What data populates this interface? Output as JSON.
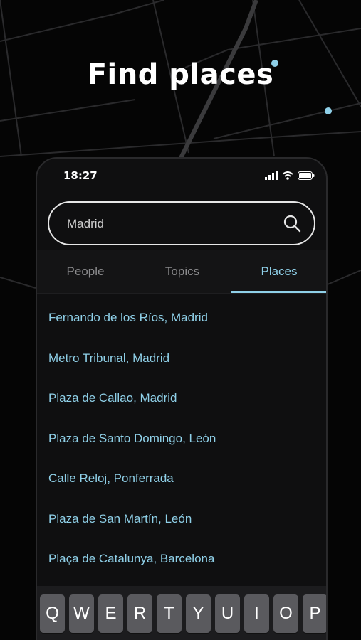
{
  "headline": "Find places",
  "status_bar": {
    "time": "18:27"
  },
  "search": {
    "value": "Madrid"
  },
  "tabs": [
    {
      "label": "People",
      "active": false
    },
    {
      "label": "Topics",
      "active": false
    },
    {
      "label": "Places",
      "active": true
    }
  ],
  "results": [
    "Fernando de los Ríos, Madrid",
    "Metro Tribunal, Madrid",
    "Plaza de Callao, Madrid",
    "Plaza de Santo Domingo, León",
    "Calle Reloj, Ponferrada",
    "Plaza de San Martín, León",
    "Plaça de Catalunya, Barcelona"
  ],
  "keyboard": {
    "row1": [
      "Q",
      "W",
      "E",
      "R",
      "T",
      "Y",
      "U",
      "I",
      "O",
      "P"
    ]
  },
  "colors": {
    "accent": "#8fd0e8",
    "background": "#050505",
    "panel": "#0f0f10"
  },
  "icons": [
    "search-icon",
    "signal-icon",
    "wifi-icon",
    "battery-icon"
  ]
}
